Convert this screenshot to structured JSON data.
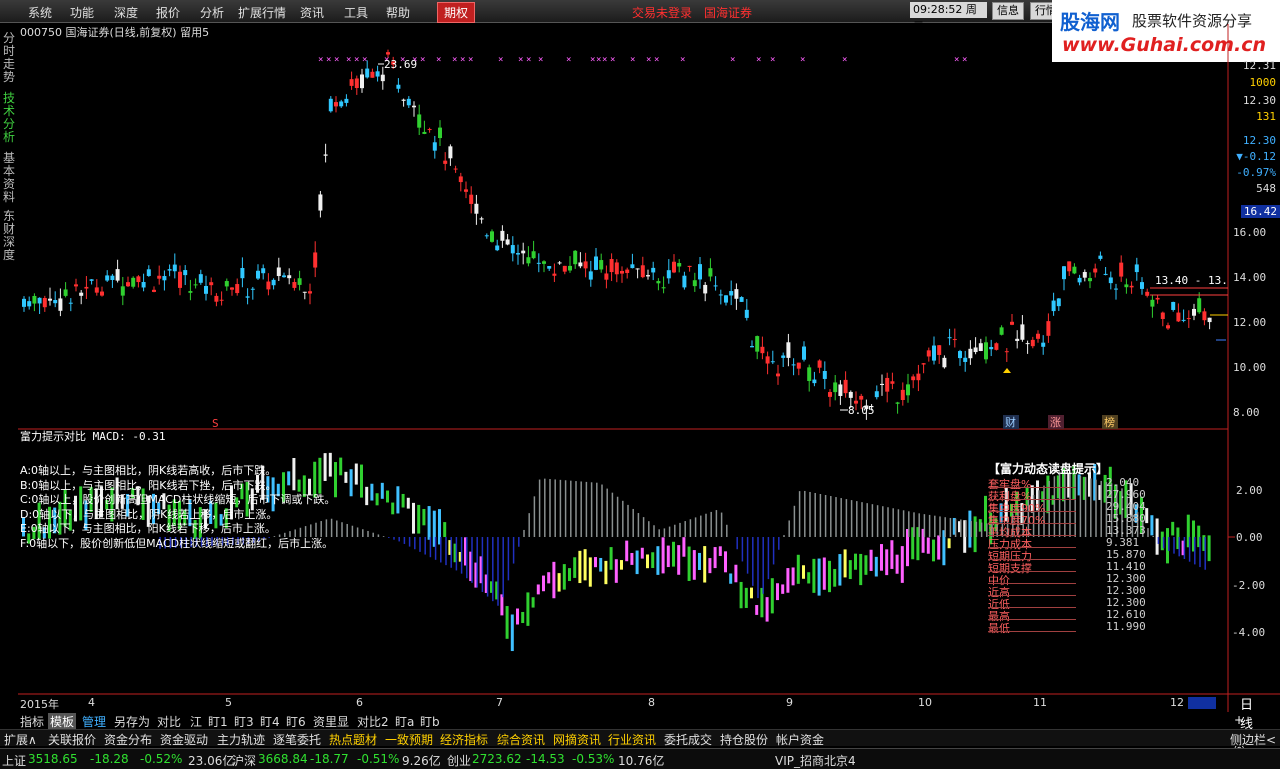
{
  "menu": {
    "items": [
      "系统",
      "功能",
      "深度",
      "报价",
      "分析",
      "扩展行情",
      "资讯",
      "工具",
      "帮助"
    ],
    "highlight": "期权",
    "trade_status": "交易未登录",
    "broker": "国海证券",
    "clock": "09:28:52",
    "weekday": "周二",
    "btn_info": "信息",
    "btn_quote": "行情"
  },
  "logo": {
    "brand": "股海网",
    "slogan": "股票软件资源分享",
    "url": "www.Guhai.com.cn"
  },
  "left_nav": [
    "分时走势",
    "技术分析",
    "基本资料",
    "东财深度"
  ],
  "chart": {
    "title": "000750 国海证券(日线,前复权) 留用5",
    "high_label": "23.69",
    "low_label": "8.05",
    "right_label": "13.40 - 13.",
    "markers": {
      "s": "S",
      "cai": "财",
      "zhang": "涨",
      "bang": "榜"
    }
  },
  "right_values": {
    "v1": "12.31",
    "v2": "1000",
    "v3": "12.30",
    "v4": "131",
    "v5": "12.30",
    "v6": "▼-0.12",
    "v7": "-0.97%",
    "v8": "548",
    "v9": "16.42"
  },
  "price_axis": [
    "16.00",
    "14.00",
    "12.00",
    "10.00",
    "8.00"
  ],
  "indicator": {
    "title": "富力提示对比 MACD: -0.31",
    "axis": [
      "2.00",
      "0.00",
      "-2.00",
      "-4.00"
    ],
    "lines": [
      "A:0轴以上，与主图相比，阴K线若高收，后市下跌。",
      "B:0轴以上，与主图相比，阳K线若下挫，后市下跌。",
      "C:0轴以上，股价创新高但MACD柱状线缩短，后市下调或下跌。",
      "D:0轴以下，与主图相比，阴K线若上移，后市上涨。",
      "E:0轴以下，与主图相比，阳K线若下移，后市上涨。",
      "F:0轴以下，股价创新低但MACD柱状线缩短或翻红，后市上涨。"
    ]
  },
  "summary": {
    "title": "【富力动态读盘提示】",
    "rows": [
      {
        "label": "套牢盘%",
        "value": "2.040"
      },
      {
        "label": "获利盘%",
        "value": "27.960"
      },
      {
        "label": "集中度90%",
        "value": "29.404"
      },
      {
        "label": "集中度70%",
        "value": "15.880"
      },
      {
        "label": "平均成本",
        "value": "13.373"
      },
      {
        "label": "压力成本",
        "value": "9.381"
      },
      {
        "label": "短期压力",
        "value": "15.870"
      },
      {
        "label": "短期支撑",
        "value": "11.410"
      },
      {
        "label": "中价",
        "value": "12.300"
      },
      {
        "label": "近高",
        "value": "12.300"
      },
      {
        "label": "近低",
        "value": "12.300"
      },
      {
        "label": "最高",
        "value": "12.610"
      },
      {
        "label": "最低",
        "value": "11.990"
      }
    ]
  },
  "months": {
    "year": "2015年",
    "labels": [
      "4",
      "5",
      "6",
      "7",
      "8",
      "9",
      "10",
      "11",
      "12"
    ],
    "period": "日线"
  },
  "tabs1": [
    "指标",
    "模板",
    "管理",
    "另存为",
    "对比",
    "江",
    "盯1",
    "盯3",
    "盯4",
    "盯6",
    "资里显",
    "对比2",
    "盯a",
    "盯b"
  ],
  "tabs1_extra": "+ - ◎",
  "tabs2": [
    "扩展∧",
    "关联报价",
    "资金分布",
    "资金驱动",
    "主力轨迹",
    "逐笔委托",
    "热点题材",
    "一致预期",
    "经济指标",
    "综合资讯",
    "网摘资讯",
    "行业资讯",
    "委托成交",
    "持仓股份",
    "帐户资金"
  ],
  "tabs2_right": "侧边栏<",
  "status": {
    "sh_name": "上证",
    "sh_val": "3518.65",
    "sh_chg": "-18.28",
    "sh_pct": "-0.52%",
    "sh_amt": "23.06亿",
    "hs_name": "沪深",
    "hs_val": "3668.84",
    "hs_chg": "-18.77",
    "hs_pct": "-0.51%",
    "hs_amt": "9.26亿",
    "cy_name": "创业",
    "cy_val": "2723.62",
    "cy_chg": "-14.53",
    "cy_pct": "-0.53%",
    "cy_amt": "10.76亿",
    "vip": "VIP_招商北京4"
  },
  "colors": {
    "up": "#ff3030",
    "down": "#30c8ff",
    "green": "#30d030",
    "magenta": "#ff60ff",
    "axis": "#ff3030"
  }
}
